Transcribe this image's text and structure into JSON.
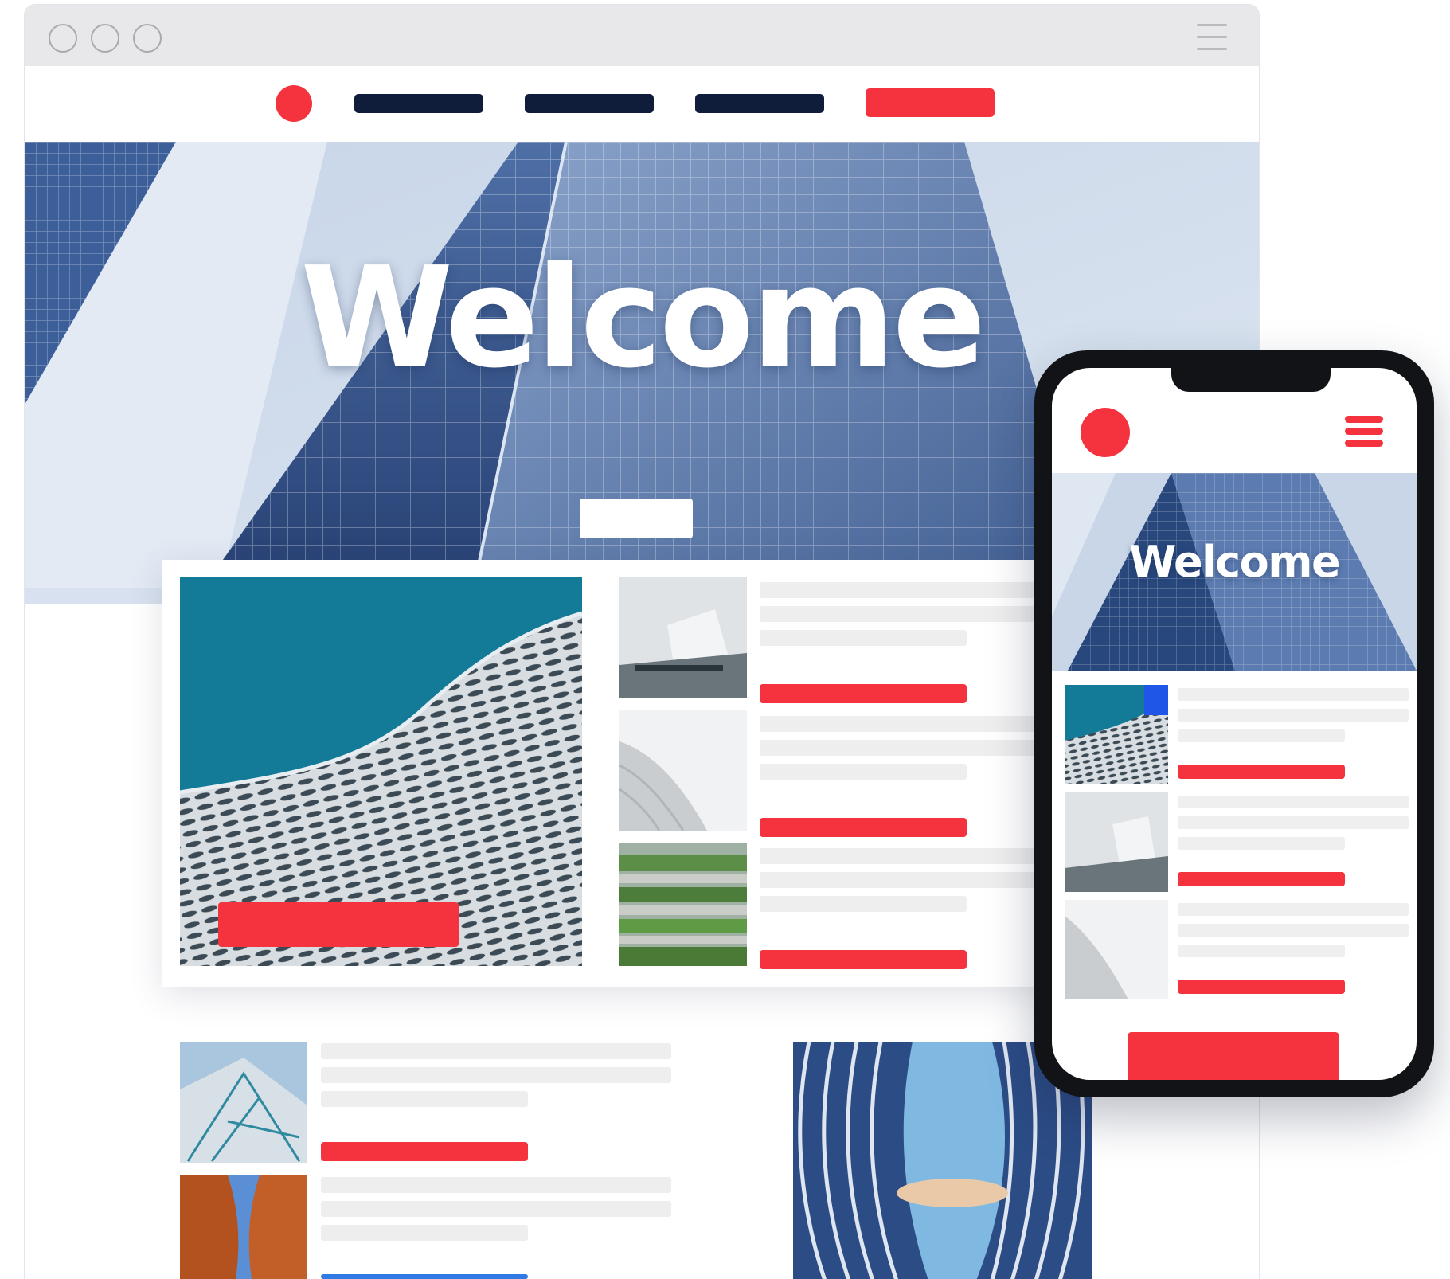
{
  "colors": {
    "brand_red": "#f5333f",
    "nav_navy": "#0f1c3a",
    "placeholder_gray": "#eeeeee",
    "chrome_gray": "#e8e8ea"
  },
  "browser": {
    "window_controls": [
      "window-dot-1",
      "window-dot-2",
      "window-dot-3"
    ],
    "menu_icon": "menu-lines-icon"
  },
  "desktop": {
    "hero_title": "Welcome",
    "nav_items": [
      "nav-item-1",
      "nav-item-2",
      "nav-item-3"
    ],
    "nav_cta": "nav-cta"
  },
  "mobile": {
    "hero_title": "Welcome",
    "menu_icon": "hamburger-icon"
  }
}
